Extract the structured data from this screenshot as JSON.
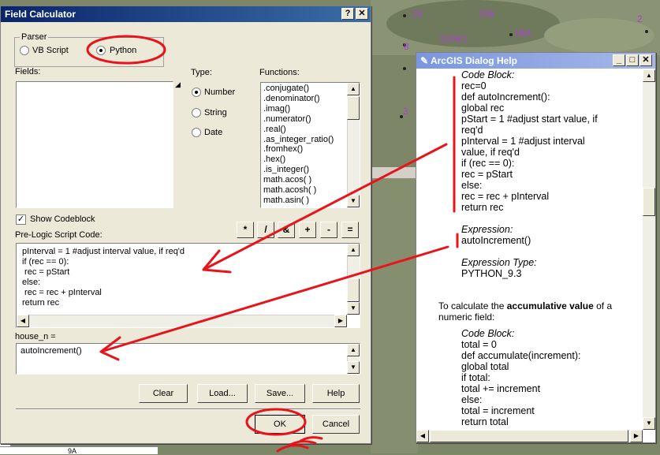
{
  "map": {
    "labels": [
      "16",
      "16Б",
      "2",
      "22АК1",
      "16А",
      "8",
      "3"
    ],
    "table_bottom_text": "9А"
  },
  "field_calculator": {
    "title": "Field Calculator",
    "help_btn": "?",
    "close_btn": "✕",
    "parser": {
      "label": "Parser",
      "vb_script": "VB Script",
      "python": "Python",
      "selected": "Python"
    },
    "fields_label": "Fields:",
    "type": {
      "label": "Type:",
      "options": [
        "Number",
        "String",
        "Date"
      ],
      "selected": "Number"
    },
    "functions": {
      "label": "Functions:",
      "items": [
        ".conjugate()",
        ".denominator()",
        ".imag()",
        ".numerator()",
        ".real()",
        ".as_integer_ratio()",
        ".fromhex()",
        ".hex()",
        ".is_integer()",
        "math.acos( )",
        "math.acosh( )",
        "math.asin( )"
      ]
    },
    "show_codeblock": {
      "label": "Show Codeblock",
      "checked": true
    },
    "operators": [
      "*",
      "/",
      "&",
      "+",
      "-",
      "="
    ],
    "prelogic": {
      "label": "Pre-Logic Script Code:",
      "lines": [
        "pInterval = 1 #adjust interval value, if req'd",
        "if (rec == 0):",
        " rec = pStart",
        "else:",
        " rec = rec + pInterval",
        "return rec"
      ]
    },
    "expression": {
      "label": "house_n =",
      "value": "autoIncrement()"
    },
    "buttons": {
      "clear": "Clear",
      "load": "Load...",
      "save": "Save...",
      "help": "Help",
      "ok": "OK",
      "cancel": "Cancel"
    }
  },
  "help_window": {
    "title": "ArcGIS Dialog Help",
    "min_btn": "_",
    "max_btn": "□",
    "close_btn": "✕",
    "block1": {
      "code_block_label": "Code Block:",
      "code_lines": [
        "rec=0",
        "def autoIncrement():",
        " global rec",
        " pStart = 1 #adjust start value, if",
        "req'd",
        " pInterval = 1 #adjust interval",
        "value, if req'd",
        " if (rec == 0):",
        "  rec = pStart",
        " else:",
        "  rec = rec + pInterval",
        " return rec"
      ],
      "expression_label": "Expression:",
      "expression": "autoIncrement()",
      "expression_type_label": "Expression Type:",
      "expression_type": "PYTHON_9.3"
    },
    "intro": {
      "prefix": "To calculate the ",
      "bold": "accumulative value",
      "suffix": " of a",
      "line2": "numeric field:"
    },
    "block2": {
      "code_block_label": "Code Block:",
      "code_lines": [
        "total = 0",
        "def accumulate(increment):",
        " global total",
        " if total:",
        "  total += increment",
        " else:",
        "  total = increment",
        " return total"
      ]
    }
  },
  "annotation_color": "#e8141c"
}
